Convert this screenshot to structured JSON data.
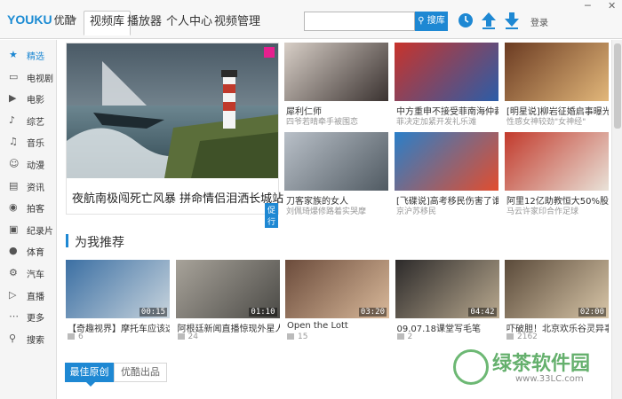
{
  "app": {
    "logo_you": "YOUKU",
    "logo_sub": "优酷"
  },
  "topnav": [
    {
      "label": "视频库",
      "active": true
    },
    {
      "label": "播放器",
      "active": false
    },
    {
      "label": "个人中心",
      "active": false
    },
    {
      "label": "视频管理",
      "active": false
    }
  ],
  "search": {
    "value": "",
    "button_label": "搜库"
  },
  "header_icons": [
    "clock-icon",
    "upload-icon",
    "download-icon"
  ],
  "login_label": "登录",
  "sidebar": {
    "items": [
      {
        "label": "精选",
        "icon": "featured-icon",
        "active": true
      },
      {
        "label": "电视剧",
        "icon": "tv-icon",
        "active": false
      },
      {
        "label": "电影",
        "icon": "film-icon",
        "active": false
      },
      {
        "label": "综艺",
        "icon": "microphone-icon",
        "active": false
      },
      {
        "label": "音乐",
        "icon": "music-note-icon",
        "active": false
      },
      {
        "label": "动漫",
        "icon": "cartoon-icon",
        "active": false
      },
      {
        "label": "资讯",
        "icon": "news-icon",
        "active": false
      },
      {
        "label": "拍客",
        "icon": "camera-icon",
        "active": false
      },
      {
        "label": "纪录片",
        "icon": "documentary-icon",
        "active": false
      },
      {
        "label": "体育",
        "icon": "sports-icon",
        "active": false
      },
      {
        "label": "汽车",
        "icon": "car-icon",
        "active": false
      },
      {
        "label": "直播",
        "icon": "live-icon",
        "active": false
      },
      {
        "label": "更多",
        "icon": "more-icon",
        "active": false
      },
      {
        "label": "搜索",
        "icon": "search-icon",
        "active": false
      }
    ]
  },
  "hero": {
    "title": "夜航南极闯死亡风暴 拼命情侣泪洒长城站",
    "badge": "促行"
  },
  "grid": [
    {
      "title": "犀利仁师",
      "subtitle": "四爷若晴牵手被围恋"
    },
    {
      "title": "中方重申不接受菲南海仲裁",
      "subtitle": "菲决定加紧开发礼乐滩"
    },
    {
      "title": "[明星说]柳岩征婚启事曝光",
      "subtitle": "性感女神较劲\"女神经\""
    },
    {
      "title": "刀客家族的女人",
      "subtitle": "刘佩琦爆修路着实哭摩"
    },
    {
      "title": "[飞碟说]高考移民伤害了谁",
      "subtitle": "京沪苏移民"
    },
    {
      "title": "阿里12亿助教恒大50%股",
      "subtitle": "马云许家印合作足球"
    }
  ],
  "section": {
    "title": "为我推荐"
  },
  "recommended": [
    {
      "title": "【奇趣视界】摩托车应该这样",
      "duration": "00:15",
      "views": "6"
    },
    {
      "title": "阿根廷新闻直播惊现外星人外",
      "duration": "01:10",
      "views": "24"
    },
    {
      "title": "Open the Lott",
      "duration": "03:20",
      "views": "15"
    },
    {
      "title": "09.07.18课堂写毛笔",
      "duration": "04:42",
      "views": "2"
    },
    {
      "title": "吓破胆！北京欢乐谷灵异事件",
      "duration": "02:00",
      "views": "2162"
    }
  ],
  "tabs": [
    {
      "label": "最佳原创",
      "active": true
    },
    {
      "label": "优酷出品",
      "active": false
    }
  ],
  "watermark": {
    "text": "绿茶软件园",
    "url": "www.33LC.com"
  },
  "colors": {
    "accent": "#1e88d3",
    "brand_blue": "#1b8bd3",
    "brand_orange": "#e8471b"
  }
}
